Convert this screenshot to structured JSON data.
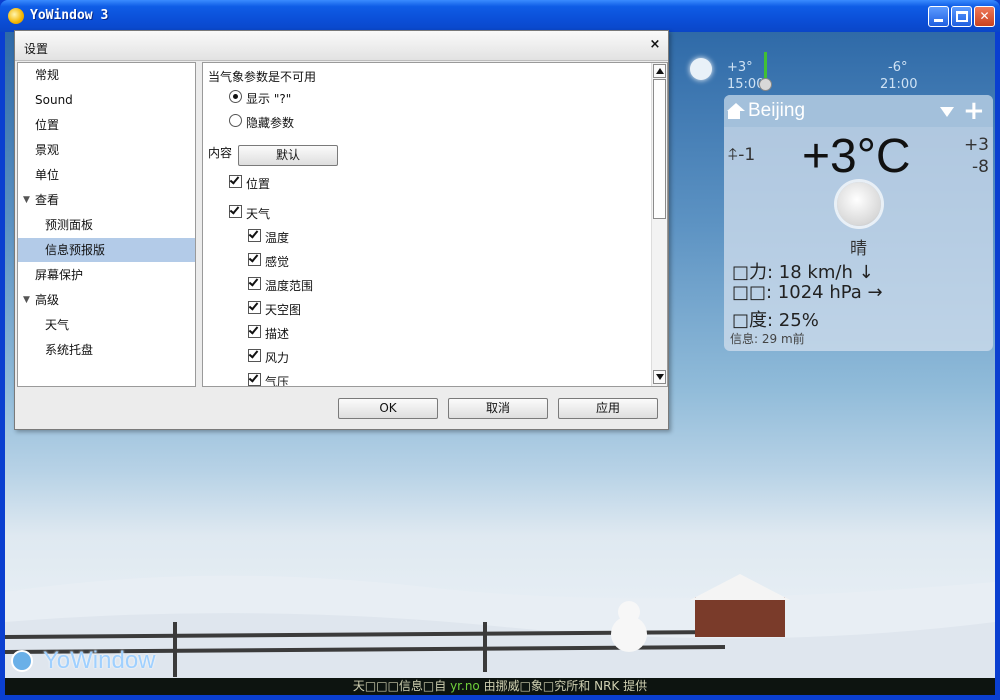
{
  "app": {
    "title": "YoWindow 3",
    "logo_text": "YoWindow"
  },
  "credit": {
    "prefix": "天□□□信息□自 ",
    "link": "yr.no",
    "suffix": " 由挪威□象□究所和 NRK 提供"
  },
  "timeline": {
    "now_temp": "+3°",
    "now_time": "15:00",
    "later_temp": "-6°",
    "later_time": "21:00"
  },
  "weather": {
    "city": "Beijing",
    "feels_like": "-1",
    "temperature": "+3°C",
    "high": "+3",
    "low": "-8",
    "condition": "晴",
    "wind": "□力:  18 km/h ↓",
    "pressure": "□□:  1024 hPa →",
    "humidity": "□度:  25%",
    "updated": "信息: 29 m前"
  },
  "dialog": {
    "title": "设置",
    "close": "×",
    "nav": [
      {
        "label": "常规"
      },
      {
        "label": "Sound"
      },
      {
        "label": "位置"
      },
      {
        "label": "景观"
      },
      {
        "label": "单位"
      },
      {
        "label": "查看",
        "expanded": true
      },
      {
        "label": "预测面板"
      },
      {
        "label": "信息预报版",
        "selected": true
      },
      {
        "label": "屏幕保护"
      },
      {
        "label": "高级",
        "expanded": true
      },
      {
        "label": "天气"
      },
      {
        "label": "系统托盘"
      }
    ],
    "content": {
      "unavailable_heading": "当气象参数是不可用",
      "radio_show": "显示 \"?\"",
      "radio_hide": "隐藏参数",
      "show_selected": true,
      "content_label": "内容",
      "default_button": "默认",
      "checks": [
        {
          "label": "位置",
          "checked": true
        },
        {
          "label": "天气",
          "checked": true
        },
        {
          "label": "温度",
          "checked": true
        },
        {
          "label": "感觉",
          "checked": true
        },
        {
          "label": "温度范围",
          "checked": true
        },
        {
          "label": "天空图",
          "checked": true
        },
        {
          "label": "描述",
          "checked": true
        },
        {
          "label": "风力",
          "checked": true
        },
        {
          "label": "气压",
          "checked": true
        }
      ]
    },
    "buttons": {
      "ok": "OK",
      "cancel": "取消",
      "apply": "应用"
    }
  }
}
